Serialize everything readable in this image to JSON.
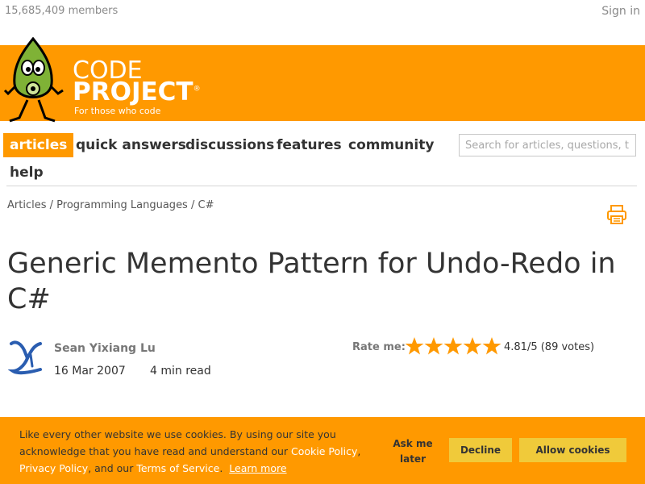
{
  "header": {
    "members": "15,685,409 members",
    "signin": "Sign in"
  },
  "logo": {
    "word1": "CODE",
    "word2": "PROJECT",
    "registered": "®",
    "tagline": "For those who code"
  },
  "nav": {
    "items": [
      "articles",
      "quick answers",
      "discussions",
      "features",
      "community",
      "help"
    ],
    "active": "articles",
    "search_placeholder": "Search for articles, questions, tips"
  },
  "breadcrumb": [
    "Articles",
    "Programming Languages",
    "C#"
  ],
  "breadcrumb_sep": "/",
  "article": {
    "title": "Generic Memento Pattern for Undo-Redo in C#",
    "author": "Sean Yixiang Lu",
    "date": "16 Mar 2007",
    "read_time": "4 min read",
    "rate_label": "Rate me:",
    "rating_text": "4.81/5 (89 votes)",
    "stars_filled": 5,
    "stars_total": 5
  },
  "cookie": {
    "text_1": "Like every other website we use cookies. By using our site you acknowledge that you have read and understand our ",
    "cookie_policy": "Cookie Policy",
    "comma": ", ",
    "privacy_policy": "Privacy Policy",
    "text_2": ", and our ",
    "terms": "Terms of Service",
    "period": ".",
    "learn_more": "Learn more",
    "ask_later": "Ask me later",
    "decline": "Decline",
    "allow": "Allow cookies"
  },
  "colors": {
    "brand_orange": "#ff9900",
    "button_yellow": "#f0ca3a",
    "star_orange": "#ff9900"
  }
}
